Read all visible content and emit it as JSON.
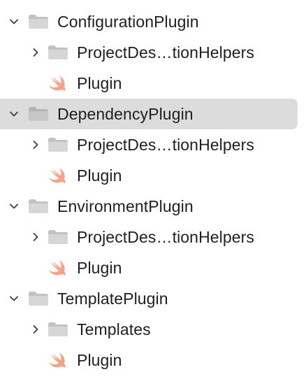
{
  "colors": {
    "folder_fill": "#d6d6d6",
    "folder_tab": "#c2c2c2",
    "swift_icon": "#f0a48a",
    "selection_bg": "#dcdcdc",
    "chevron": "#3c3c3c"
  },
  "tree": [
    {
      "label": "ConfigurationPlugin",
      "icon": "folder-icon",
      "expanded": true,
      "children": [
        {
          "label": "ProjectDes…tionHelpers",
          "icon": "folder-icon",
          "expanded": false
        },
        {
          "label": "Plugin",
          "icon": "swift-file-icon"
        }
      ]
    },
    {
      "label": "DependencyPlugin",
      "icon": "folder-icon",
      "expanded": true,
      "selected": true,
      "children": [
        {
          "label": "ProjectDes…tionHelpers",
          "icon": "folder-icon",
          "expanded": false
        },
        {
          "label": "Plugin",
          "icon": "swift-file-icon"
        }
      ]
    },
    {
      "label": "EnvironmentPlugin",
      "icon": "folder-icon",
      "expanded": true,
      "children": [
        {
          "label": "ProjectDes…tionHelpers",
          "icon": "folder-icon",
          "expanded": false
        },
        {
          "label": "Plugin",
          "icon": "swift-file-icon"
        }
      ]
    },
    {
      "label": "TemplatePlugin",
      "icon": "folder-icon",
      "expanded": true,
      "children": [
        {
          "label": "Templates",
          "icon": "folder-icon",
          "expanded": false
        },
        {
          "label": "Plugin",
          "icon": "swift-file-icon"
        }
      ]
    }
  ]
}
